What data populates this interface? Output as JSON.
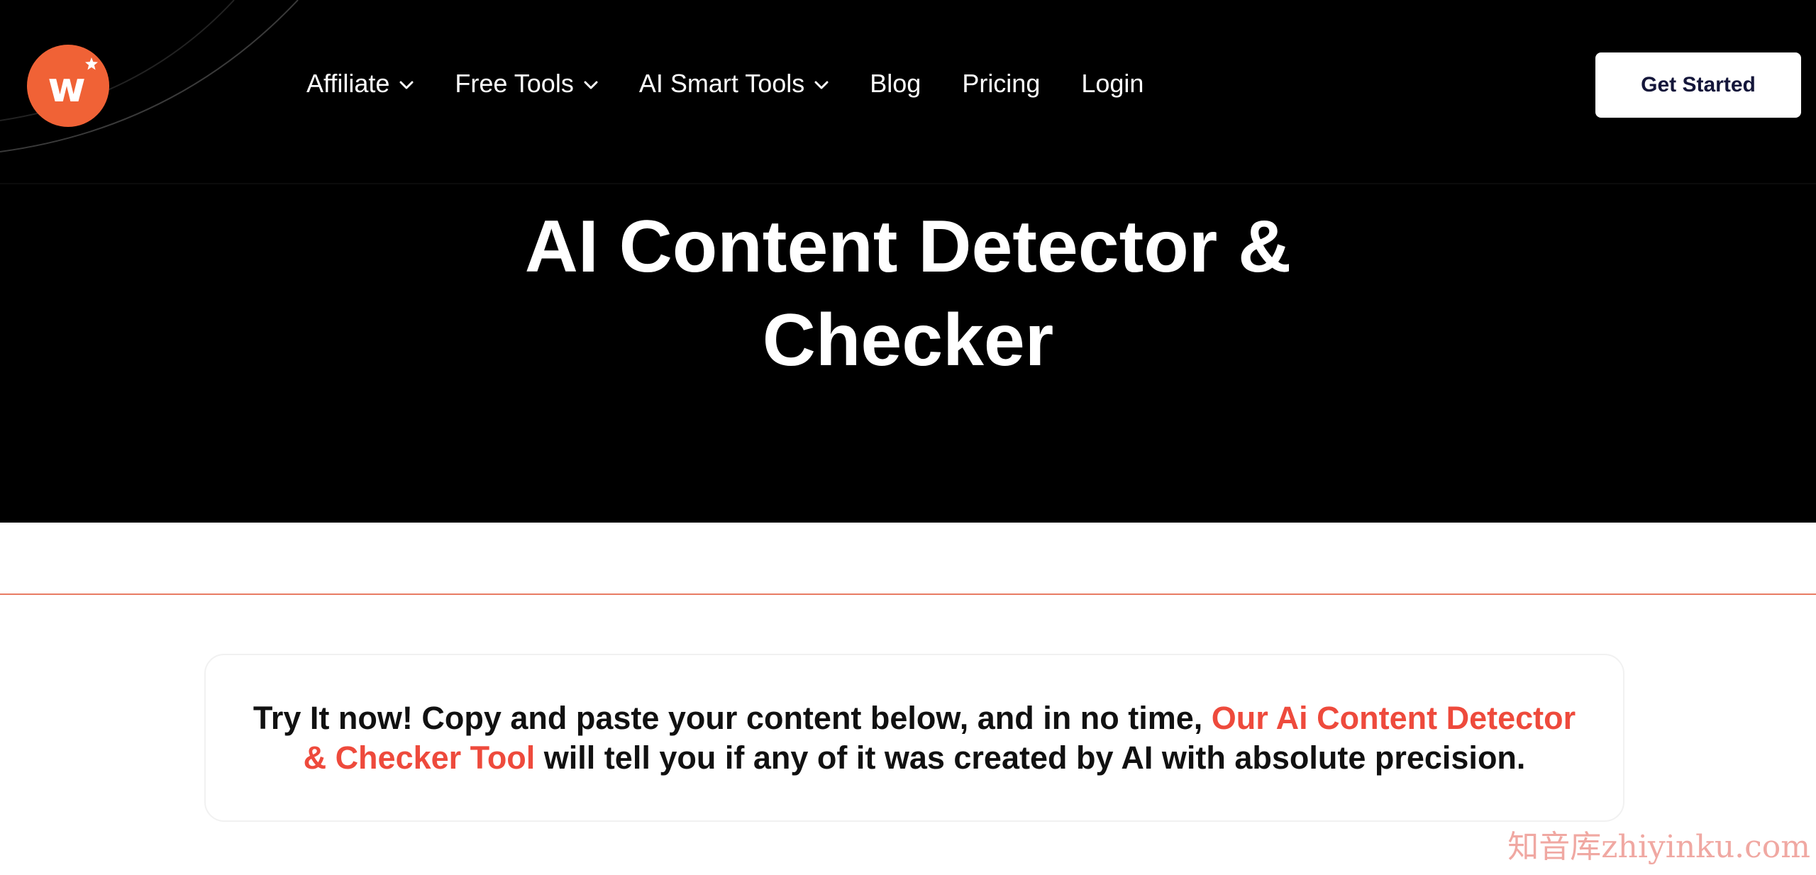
{
  "header": {
    "logo_letter": "w",
    "nav": [
      {
        "label": "Affiliate",
        "has_dropdown": true
      },
      {
        "label": "Free Tools",
        "has_dropdown": true
      },
      {
        "label": "AI Smart Tools",
        "has_dropdown": true
      },
      {
        "label": "Blog",
        "has_dropdown": false
      },
      {
        "label": "Pricing",
        "has_dropdown": false
      },
      {
        "label": "Login",
        "has_dropdown": false
      }
    ],
    "cta_label": "Get Started"
  },
  "hero": {
    "title_line1": "AI Content Detector &",
    "title_line2": "Checker"
  },
  "intro": {
    "text_before": "Try It now! Copy and paste your content below, and in no time, ",
    "highlight": "Our Ai Content Detector & Checker Tool",
    "text_after": " will tell you if any of it was created by AI with absolute precision."
  },
  "watermark": "知音库zhiyinku.com",
  "colors": {
    "brand_orange": "#f06236",
    "highlight_red": "#ee4a3c",
    "hero_bg": "#000000",
    "cta_text": "#14163a"
  },
  "icons": {
    "logo_star": "star-icon",
    "dropdown": "chevron-down-icon"
  }
}
